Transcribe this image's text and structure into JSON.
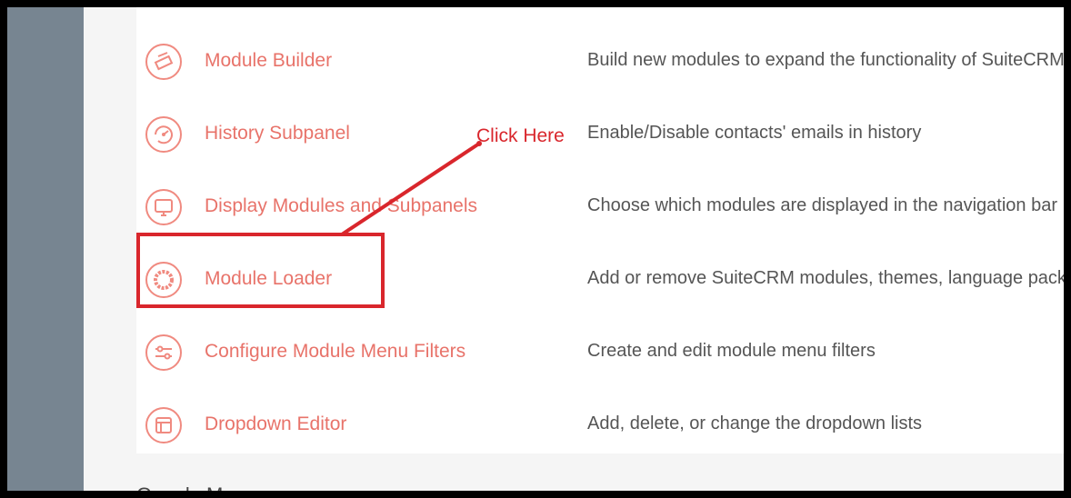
{
  "admin_rows": [
    {
      "label": "Module Builder",
      "description": "Build new modules to expand the functionality of SuiteCRM",
      "icon": "module-builder-icon"
    },
    {
      "label": "History Subpanel",
      "description": "Enable/Disable contacts' emails in history",
      "icon": "history-icon"
    },
    {
      "label": "Display Modules and Subpanels",
      "description": "Choose which modules are displayed in the navigation bar",
      "icon": "monitor-icon"
    },
    {
      "label": "Module Loader",
      "description": "Add or remove SuiteCRM modules, themes, language packs",
      "icon": "module-loader-icon"
    },
    {
      "label": "Configure Module Menu Filters",
      "description": "Create and edit module menu filters",
      "icon": "filter-sliders-icon"
    },
    {
      "label": "Dropdown Editor",
      "description": "Add, delete, or change the dropdown lists",
      "icon": "dropdown-editor-icon"
    }
  ],
  "next_section_title": "Google Maps",
  "annotation": {
    "text": "Click Here",
    "color": "#d9262c"
  },
  "colors": {
    "accent": "#e8736a",
    "sidebar": "#778591"
  }
}
